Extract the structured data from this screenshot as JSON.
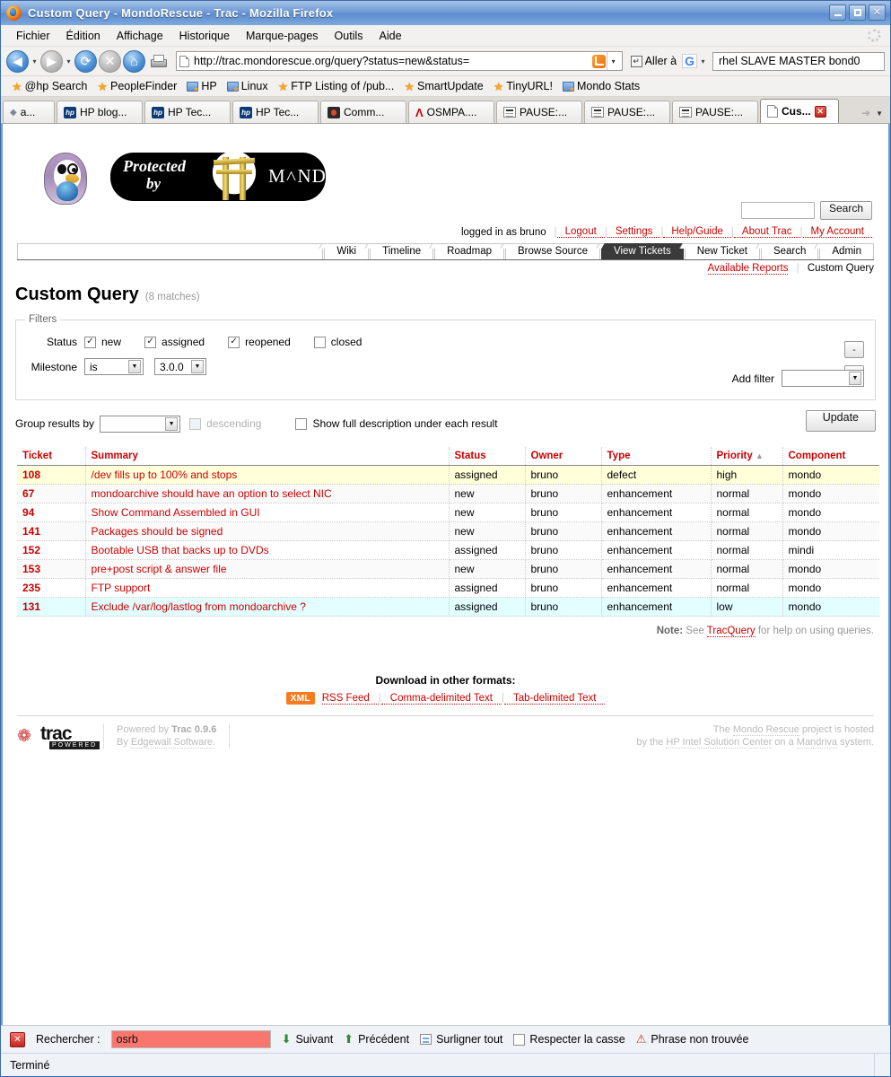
{
  "window": {
    "title": "Custom Query - MondoRescue - Trac - Mozilla Firefox",
    "minimize_label": "_",
    "maximize_label": "□",
    "close_label": "✕"
  },
  "menubar": [
    {
      "label": "Fichier",
      "accel": "F"
    },
    {
      "label": "Édition",
      "accel": "n"
    },
    {
      "label": "Affichage",
      "accel": "A"
    },
    {
      "label": "Historique",
      "accel": "H"
    },
    {
      "label": "Marque-pages",
      "accel": "M"
    },
    {
      "label": "Outils",
      "accel": "O"
    },
    {
      "label": "Aide",
      "accel": "e"
    }
  ],
  "navbar": {
    "back_icon": "back-arrow-icon",
    "forward_icon": "forward-arrow-icon",
    "reload_icon": "reload-icon",
    "stop_icon": "stop-icon",
    "home_icon": "home-icon",
    "print_icon": "print-icon",
    "url": "http://trac.mondorescue.org/query?status=new&status=",
    "feed_icon": "rss-feed-icon",
    "go_label": "Aller à",
    "google_label": "G",
    "search_value": "rhel SLAVE MASTER bond0"
  },
  "bookmarks": [
    {
      "label": "@hp Search",
      "icon": "star-icon"
    },
    {
      "label": "PeopleFinder",
      "icon": "star-icon"
    },
    {
      "label": "HP",
      "icon": "folder-icon"
    },
    {
      "label": "Linux",
      "icon": "folder-icon"
    },
    {
      "label": "FTP Listing of /pub...",
      "icon": "star-icon"
    },
    {
      "label": "SmartUpdate",
      "icon": "star-icon"
    },
    {
      "label": "TinyURL!",
      "icon": "star-icon"
    },
    {
      "label": "Mondo Stats",
      "icon": "folder-icon"
    }
  ],
  "tabs": [
    {
      "label": "a...",
      "icon": "arrow-icon",
      "active": false
    },
    {
      "label": "HP blog...",
      "icon": "hp-icon",
      "active": false
    },
    {
      "label": "HP Tec...",
      "icon": "hp-icon",
      "active": false
    },
    {
      "label": "HP Tec...",
      "icon": "hp-icon",
      "active": false
    },
    {
      "label": "Comm...",
      "icon": "community-icon",
      "active": false
    },
    {
      "label": "OSMPA....",
      "icon": "osmpa-icon",
      "active": false
    },
    {
      "label": "PAUSE:...",
      "icon": "pause-icon",
      "active": false
    },
    {
      "label": "PAUSE:...",
      "icon": "pause-icon",
      "active": false
    },
    {
      "label": "PAUSE:...",
      "icon": "pause-icon",
      "active": false
    },
    {
      "label": "Cus...",
      "icon": "document-icon",
      "active": true
    }
  ],
  "trac": {
    "logo_alt": "MondoRescue penguin logo",
    "banner": {
      "protected": "Protected",
      "by": "by",
      "wordmark": "M˄NDO"
    },
    "search": {
      "value": "",
      "button_label": "Search"
    },
    "metanav": {
      "logged_in": "logged in as bruno",
      "links": [
        "Logout",
        "Settings",
        "Help/Guide",
        "About Trac",
        "My Account"
      ]
    },
    "mainnav": [
      {
        "label": "Wiki",
        "active": false
      },
      {
        "label": "Timeline",
        "active": false
      },
      {
        "label": "Roadmap",
        "active": false
      },
      {
        "label": "Browse Source",
        "active": false
      },
      {
        "label": "View Tickets",
        "active": true
      },
      {
        "label": "New Ticket",
        "active": false
      },
      {
        "label": "Search",
        "active": false
      },
      {
        "label": "Admin",
        "active": false
      }
    ],
    "subnav": {
      "available_reports": "Available Reports",
      "current": "Custom Query"
    }
  },
  "query": {
    "title": "Custom Query",
    "matches": "(8 matches)",
    "filters_legend": "Filters",
    "status": {
      "label": "Status",
      "options": [
        {
          "label": "new",
          "checked": true
        },
        {
          "label": "assigned",
          "checked": true
        },
        {
          "label": "reopened",
          "checked": true
        },
        {
          "label": "closed",
          "checked": false
        }
      ]
    },
    "milestone": {
      "label": "Milestone",
      "operator": "is",
      "value": "3.0.0"
    },
    "remove_button_label": "-",
    "add_filter_label": "Add filter",
    "add_filter_value": "",
    "group_by_label": "Group results by",
    "group_by_value": "",
    "descending_label": "descending",
    "show_description_label": "Show full description under each result",
    "update_label": "Update"
  },
  "table": {
    "columns": [
      "Ticket",
      "Summary",
      "Status",
      "Owner",
      "Type",
      "Priority",
      "Component"
    ],
    "sorted_column": "Priority",
    "sort_arrow": "▲",
    "rows": [
      {
        "ticket": "108",
        "summary": "/dev fills up to 100% and stops",
        "status": "assigned",
        "owner": "bruno",
        "type": "defect",
        "priority": "high",
        "component": "mondo",
        "highlight": "yellow"
      },
      {
        "ticket": "67",
        "summary": "mondoarchive should have an option to select NIC",
        "status": "new",
        "owner": "bruno",
        "type": "enhancement",
        "priority": "normal",
        "component": "mondo",
        "highlight": "even"
      },
      {
        "ticket": "94",
        "summary": "Show Command Assembled in GUI",
        "status": "new",
        "owner": "bruno",
        "type": "enhancement",
        "priority": "normal",
        "component": "mondo",
        "highlight": "odd"
      },
      {
        "ticket": "141",
        "summary": "Packages should be signed",
        "status": "new",
        "owner": "bruno",
        "type": "enhancement",
        "priority": "normal",
        "component": "mondo",
        "highlight": "even"
      },
      {
        "ticket": "152",
        "summary": "Bootable USB that backs up to DVDs",
        "status": "assigned",
        "owner": "bruno",
        "type": "enhancement",
        "priority": "normal",
        "component": "mindi",
        "highlight": "odd"
      },
      {
        "ticket": "153",
        "summary": "pre+post script & answer file",
        "status": "new",
        "owner": "bruno",
        "type": "enhancement",
        "priority": "normal",
        "component": "mondo",
        "highlight": "even"
      },
      {
        "ticket": "235",
        "summary": "FTP support",
        "status": "assigned",
        "owner": "bruno",
        "type": "enhancement",
        "priority": "normal",
        "component": "mondo",
        "highlight": "odd"
      },
      {
        "ticket": "131",
        "summary": "Exclude /var/log/lastlog from mondoarchive ?",
        "status": "assigned",
        "owner": "bruno",
        "type": "enhancement",
        "priority": "low",
        "component": "mondo",
        "highlight": "cyan"
      }
    ]
  },
  "note": {
    "prefix": "Note:",
    "see": "See",
    "link": "TracQuery",
    "suffix": "for help on using queries."
  },
  "downloads": {
    "title": "Download in other formats:",
    "xml_badge": "XML",
    "links": [
      "RSS Feed",
      "Comma-delimited Text",
      "Tab-delimited Text"
    ]
  },
  "footer": {
    "logo_word": "trac",
    "logo_powered": "POWERED",
    "powered_by": "Powered by",
    "trac_version": "Trac 0.9.6",
    "by_label": "By",
    "vendor": "Edgewall Software.",
    "hosted_1": "The",
    "hosted_project": "Mondo Rescue",
    "hosted_2": "project is hosted",
    "hosted_3": "by the",
    "hosted_center": "HP Intel Solution Center",
    "hosted_4": "on a",
    "hosted_distro": "Mandriva",
    "hosted_5": "system."
  },
  "findbar": {
    "close_icon": "close-icon",
    "label": "Rechercher :",
    "value": "osrb",
    "next_label": "Suivant",
    "next_accel": "S",
    "prev_label": "Précédent",
    "prev_accel": "P",
    "highlight_label": "Surligner tout",
    "highlight_accel": "u",
    "match_case_label": "Respecter la casse",
    "match_case_accel": "R",
    "match_case_checked": false,
    "status": "Phrase non trouvée"
  },
  "statusbar": {
    "text": "Terminé"
  }
}
